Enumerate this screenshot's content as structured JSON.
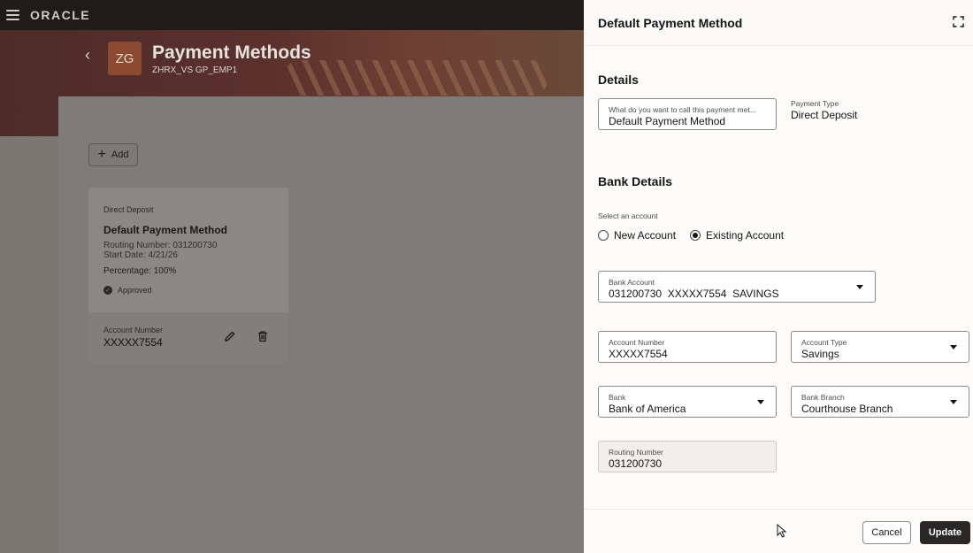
{
  "topbar": {
    "logo": "ORACLE"
  },
  "page": {
    "avatar_initials": "ZG",
    "title": "Payment Methods",
    "subtitle": "ZHRX_VS GP_EMP1"
  },
  "toolbar": {
    "add_label": "Add"
  },
  "card": {
    "type": "Direct Deposit",
    "name": "Default Payment Method",
    "routing": "Routing Number: 031200730",
    "start_date": "Start Date: 4/21/26",
    "percentage": "Percentage: 100%",
    "status": "Approved",
    "account_label": "Account Number",
    "account_number": "XXXXX7554"
  },
  "drawer": {
    "title": "Default Payment Method",
    "details_title": "Details",
    "name_field": {
      "label": "What do you want to call this payment met...",
      "value": "Default Payment Method"
    },
    "payment_type": {
      "label": "Payment Type",
      "value": "Direct Deposit"
    },
    "bank_details_title": "Bank Details",
    "select_account_label": "Select an account",
    "radio_new": "New Account",
    "radio_existing": "Existing Account",
    "selected_radio": "existing",
    "bank_account": {
      "label": "Bank Account",
      "value": "031200730  XXXXX7554  SAVINGS"
    },
    "account_number": {
      "label": "Account Number",
      "value": "XXXXX7554"
    },
    "account_type": {
      "label": "Account Type",
      "value": "Savings"
    },
    "bank": {
      "label": "Bank",
      "value": "Bank of America"
    },
    "bank_branch": {
      "label": "Bank Branch",
      "value": "Courthouse Branch"
    },
    "routing_number": {
      "label": "Routing Number",
      "value": "031200730"
    },
    "cancel_label": "Cancel",
    "update_label": "Update"
  },
  "colors": {
    "drawer_bg": "#fcfbfa",
    "primary_button": "#2a2826",
    "hero": "#5a302c",
    "avatar": "#8b4a31"
  }
}
